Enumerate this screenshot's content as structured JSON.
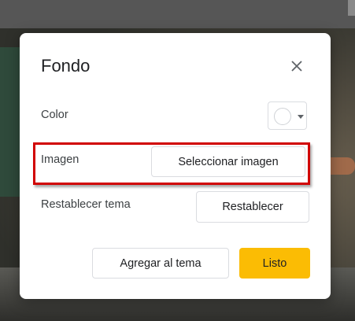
{
  "dialog": {
    "title": "Fondo",
    "close_icon": "close-icon",
    "color": {
      "label": "Color",
      "swatch_color": "#ffffff"
    },
    "image": {
      "label": "Imagen",
      "button_label": "Seleccionar imagen",
      "highlight_color": "#d10000"
    },
    "reset": {
      "label": "Restablecer tema",
      "button_label": "Restablecer"
    },
    "footer": {
      "add_to_theme_label": "Agregar al tema",
      "done_label": "Listo",
      "done_color": "#fbbc04"
    }
  }
}
